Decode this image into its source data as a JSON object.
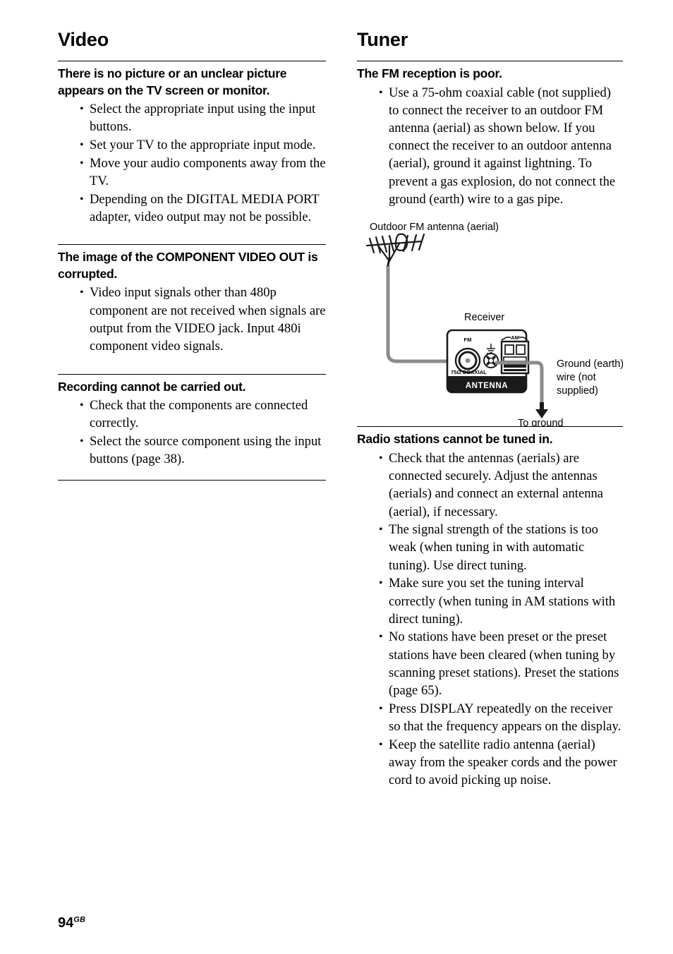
{
  "page": {
    "number": "94",
    "number_suffix": "GB"
  },
  "left_column": {
    "section_title": "Video",
    "groups": [
      {
        "heading": "There is no picture or an unclear picture appears on the TV screen or monitor.",
        "bullets": [
          "Select the appropriate input using the input buttons.",
          "Set your TV to the appropriate input mode.",
          "Move your audio components away from the TV.",
          "Depending on the DIGITAL MEDIA PORT adapter, video output may not be possible."
        ]
      },
      {
        "heading": "The image of the COMPONENT VIDEO OUT is corrupted.",
        "bullets": [
          "Video input signals other than 480p component are not received when signals are output from the VIDEO jack. Input 480i component video signals."
        ]
      },
      {
        "heading": "Recording cannot be carried out.",
        "bullets": [
          "Check that the components are connected correctly.",
          "Select the source component using the input buttons (page 38)."
        ]
      }
    ]
  },
  "right_column": {
    "section_title": "Tuner",
    "group_fm": {
      "heading": "The FM reception is poor.",
      "bullets": [
        "Use a 75-ohm coaxial cable (not supplied) to connect the receiver to an outdoor FM antenna (aerial) as shown below. If you connect the receiver to an outdoor antenna (aerial), ground it against lightning. To prevent a gas explosion, do not connect the ground (earth) wire to a gas pipe."
      ]
    },
    "diagram": {
      "antenna_label": "Outdoor FM antenna (aerial)",
      "receiver_label": "Receiver",
      "fm_jack_label": "FM",
      "coaxial_label": "75Ω COAXIAL",
      "am_label": "AM",
      "antenna_panel_label": "ANTENNA",
      "ground_wire_label_line1": "Ground (earth)",
      "ground_wire_label_line2": "wire (not",
      "ground_wire_label_line3": "supplied)",
      "to_ground_label": "To ground",
      "wire_color": "#8c8c8c",
      "panel_band_color": "#1a1a1a"
    },
    "group_radio": {
      "heading": "Radio stations cannot be tuned in.",
      "bullets": [
        "Check that the antennas (aerials) are connected securely. Adjust the antennas (aerials) and connect an external antenna (aerial), if necessary.",
        "The signal strength of the stations is too weak (when tuning in with automatic tuning). Use direct tuning.",
        "Make sure you set the tuning interval correctly (when tuning in AM stations with direct tuning).",
        "No stations have been preset or the preset stations have been cleared (when tuning by scanning preset stations). Preset the stations (page 65).",
        "Press DISPLAY repeatedly on the receiver so that the frequency appears on the display.",
        "Keep the satellite radio antenna (aerial) away from the speaker cords and the power cord to avoid picking up noise."
      ]
    }
  }
}
